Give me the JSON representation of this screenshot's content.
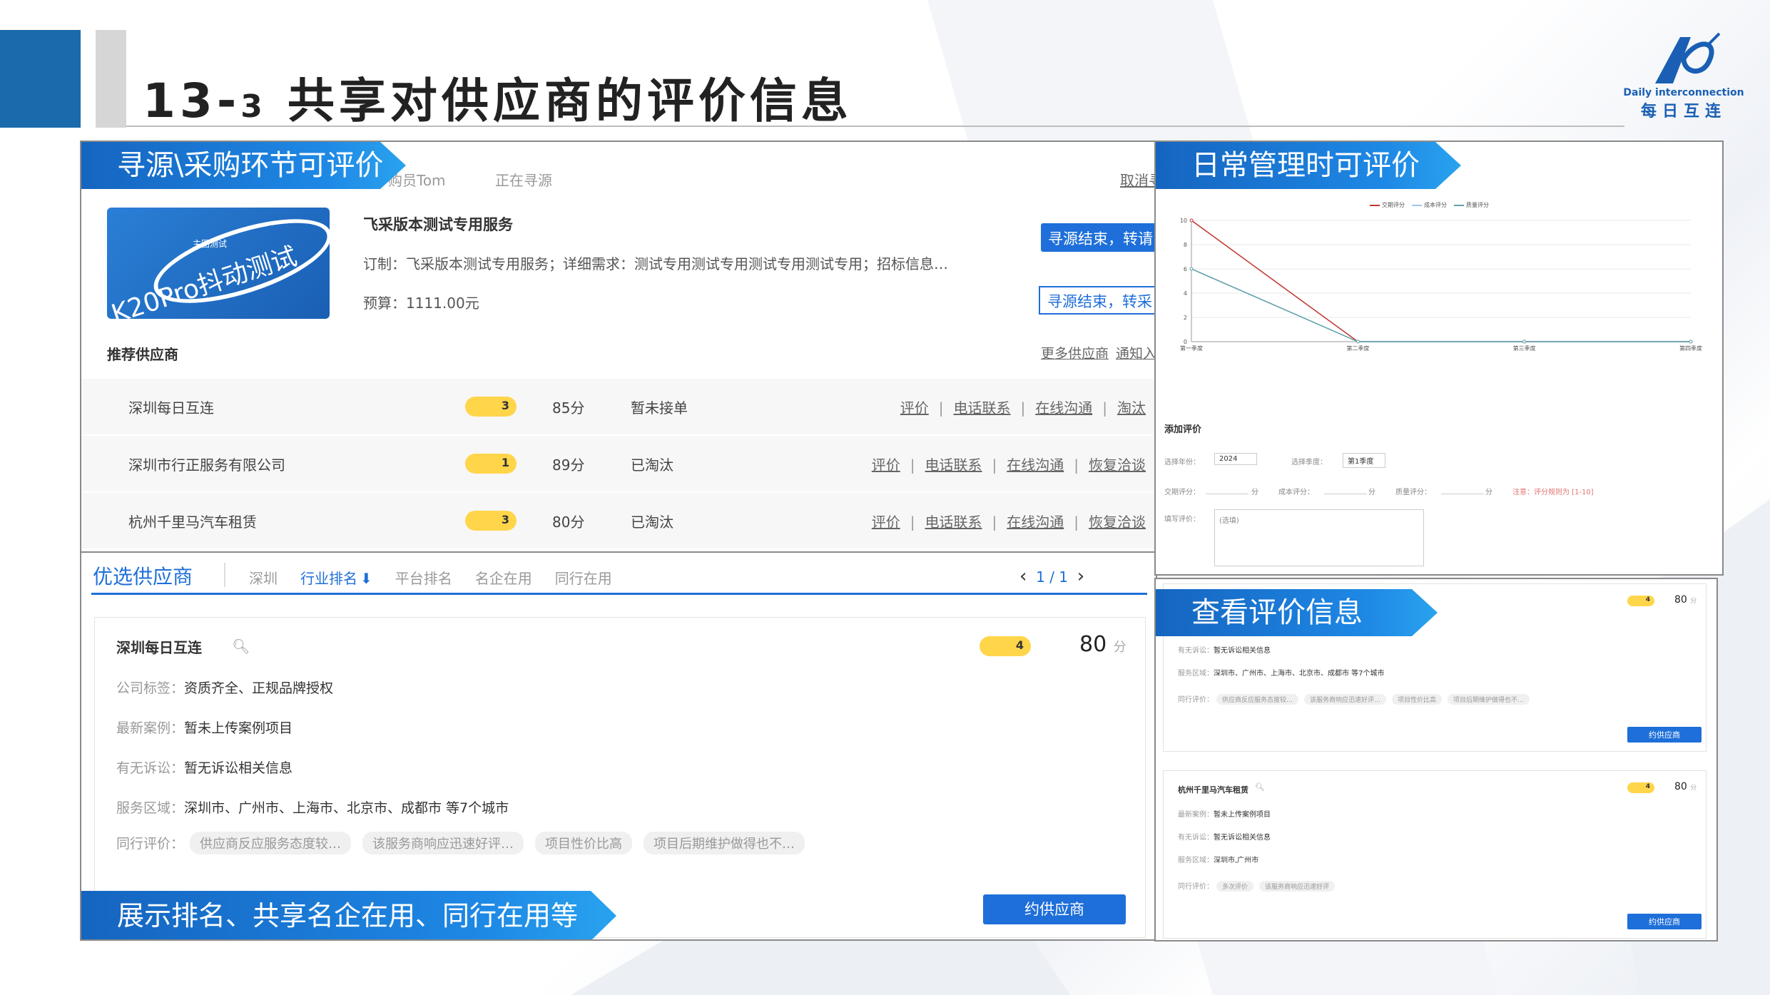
{
  "header": {
    "title_num": "13-",
    "title_small": "3",
    "title_text": "共享对供应商的评价信息"
  },
  "logo": {
    "sub": "Daily interconnection",
    "cn": "每日互连",
    "color": "#1a5fb4"
  },
  "left_top": {
    "banner": "寻源\\采购环节可评价",
    "top_meta": {
      "buyer": "购员Tom",
      "status": "正在寻源",
      "cancel": "取消寻"
    },
    "product": {
      "image_text": "K20Pro抖动测试",
      "image_small": "主图测试",
      "name": "飞采版本测试专用服务",
      "desc": "订制：飞采版本测试专用服务；详细需求：测试专用测试专用测试专用测试专用；招标信息…",
      "budget": "预算：1111.00元"
    },
    "buttons": {
      "primary": "寻源结束，转请",
      "secondary": "寻源结束，转采"
    },
    "recommend": {
      "title": "推荐供应商",
      "more": "更多供应商",
      "notify": "通知入"
    },
    "suppliers": [
      {
        "name": "深圳每日互连",
        "level": "3",
        "score": "85分",
        "status": "暂未接单",
        "actions": [
          "评价",
          "电话联系",
          "在线沟通",
          "淘汰"
        ]
      },
      {
        "name": "深圳市行正服务有限公司",
        "level": "1",
        "score": "89分",
        "status": "已淘汰",
        "actions": [
          "评价",
          "电话联系",
          "在线沟通",
          "恢复洽谈"
        ]
      },
      {
        "name": "杭州千里马汽车租赁",
        "level": "3",
        "score": "80分",
        "status": "已淘汰",
        "actions": [
          "评价",
          "电话联系",
          "在线沟通",
          "恢复洽谈"
        ]
      }
    ]
  },
  "left_bottom": {
    "tabs": {
      "title": "优选供应商",
      "items": [
        "深圳",
        "行业排名",
        "平台排名",
        "名企在用",
        "同行在用"
      ],
      "arrow": "⬇",
      "pager": "1 / 1",
      "prev": "‹",
      "next": "›"
    },
    "card": {
      "name": "深圳每日互连",
      "level": "4",
      "score": "80",
      "unit": "分",
      "rows": [
        {
          "label": "公司标签：",
          "value": "资质齐全、正规品牌授权"
        },
        {
          "label": "最新案例：",
          "value": "暂未上传案例项目"
        },
        {
          "label": "有无诉讼：",
          "value": "暂无诉讼相关信息"
        },
        {
          "label": "服务区域：",
          "value": "深圳市、广州市、上海市、北京市、成都市 等7个城市"
        }
      ],
      "peer_label": "同行评价：",
      "tags": [
        "供应商反应服务态度较…",
        "该服务商响应迅速好评…",
        "项目性价比高",
        "项目后期维护做得也不…"
      ],
      "button": "约供应商"
    },
    "banner": "展示排名、共享名企在用、同行在用等"
  },
  "right_top": {
    "banner": "日常管理时可评价",
    "legend": [
      "交期评分",
      "成本评分",
      "质量评分"
    ],
    "chart_data": {
      "type": "line",
      "categories": [
        "第一季度",
        "第二季度",
        "第三季度",
        "第四季度"
      ],
      "series": [
        {
          "name": "交期评分",
          "values": [
            10,
            0,
            0,
            0
          ],
          "color": "#c23531"
        },
        {
          "name": "成本评分",
          "values": [
            6,
            0,
            0,
            0
          ],
          "color": "#9fc5e8"
        },
        {
          "name": "质量评分",
          "values": [
            6,
            0,
            0,
            0
          ],
          "color": "#61a0a8"
        }
      ],
      "ylim": [
        0,
        10
      ],
      "yticks": [
        0,
        2,
        4,
        6,
        8,
        10
      ]
    },
    "form": {
      "title": "添加评价",
      "year_label": "选择年份：",
      "year": "2024",
      "q_label": "选择季度：",
      "q": "第1季度",
      "delivery": "交期评分：",
      "cost": "成本评分：",
      "quality": "质量评分：",
      "unit": "分",
      "note": "注意：评分规则为 [1-10]",
      "fill": "填写评价：",
      "placeholder": "(选填)"
    }
  },
  "right_bottom": {
    "banner": "查看评价信息",
    "cards": [
      {
        "name": "",
        "level": "4",
        "score": "80",
        "unit": "分",
        "rows": [
          {
            "label": "最新案例：",
            "value": "暂未上传案例项目"
          },
          {
            "label": "有无诉讼：",
            "value": "暂无诉讼相关信息"
          },
          {
            "label": "服务区域：",
            "value": "深圳市、广州市、上海市、北京市、成都市 等7个城市"
          }
        ],
        "peer_label": "同行评价：",
        "tags": [
          "供应商反应服务态度较…",
          "该服务商响应迅速好评…",
          "项目性价比高",
          "项目后期维护做得也不…"
        ],
        "button": "约供应商"
      },
      {
        "name": "杭州千里马汽车租赁",
        "level": "4",
        "score": "80",
        "unit": "分",
        "rows": [
          {
            "label": "最新案例：",
            "value": "暂未上传案例项目"
          },
          {
            "label": "有无诉讼：",
            "value": "暂无诉讼相关信息"
          },
          {
            "label": "服务区域：",
            "value": "深圳市,广州市"
          }
        ],
        "peer_label": "同行评价：",
        "tags": [
          "多次评价",
          "该服务商响应迅速好评"
        ],
        "button": "约供应商"
      }
    ]
  }
}
